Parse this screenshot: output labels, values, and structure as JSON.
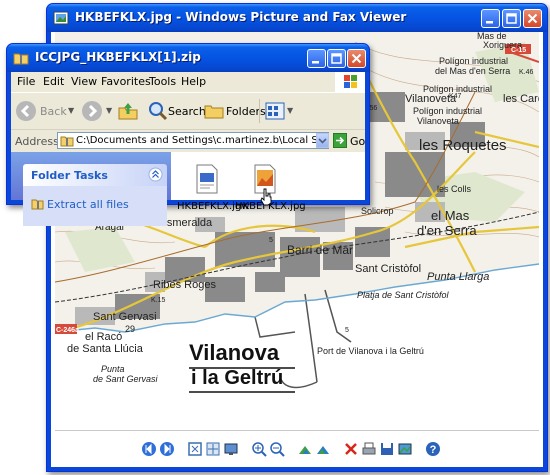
{
  "viewer": {
    "title": "HKBEFKLX.jpg - Windows Picture and Fax Viewer",
    "map_labels": {
      "mas_de_sitja": "Mas de",
      "xoriguera": "Xoriguera",
      "poligon1": "Polígon industrial",
      "mas_serra1": "del Mas d'en Serra",
      "poligon2": "Polígon industrial",
      "vilanoveta": "Vilanoveta",
      "los_cards": "les Cards",
      "poligon3": "Polígon industrial",
      "vilanoveta2": "Vilanoveta",
      "roquetes": "les Roquetes",
      "colls": "les Colls",
      "solicrop": "Solicrop",
      "mas_serra2a": "el Mas",
      "mas_serra2b": "d'en Serra",
      "esmeralda": "l'Esmeralda",
      "aragai": "Aragai",
      "barri_mar": "Barri de Mar",
      "sant_cristofol": "Sant Cristòfol",
      "punta_llarga": "Punta Llarga",
      "ribes_roges": "Ribes Roges",
      "platja_cristofol": "Platja de Sant Cristòfol",
      "sant_gervasi": "Sant Gervasi",
      "raco1": "el Racó",
      "raco2": "de Santa Llúcia",
      "punta": "Punta",
      "punta_gervasi": "de Sant Gervasi",
      "vilanova": "Vilanova",
      "geltru": "i la Geltrú",
      "port": "Port de Vilanova i la Geltrú",
      "road_c246": "C-246a",
      "road_c15": "C-15",
      "road_k47": "K47",
      "road_k15": "K.15",
      "road_k46": "K.46",
      "road_k156": "K.156",
      "km29": "29",
      "num5a": "5",
      "num5b": "5"
    }
  },
  "explorer": {
    "title": "ICCJPG_HKBEFKLX[1].zip",
    "menu": [
      "File",
      "Edit",
      "View",
      "Favorites",
      "Tools",
      "Help"
    ],
    "toolbar": {
      "back": "Back",
      "search": "Search",
      "folders": "Folders"
    },
    "address": {
      "label": "Address",
      "value": "C:\\Documents and Settings\\c.martinez.b\\Local Settings\\Temporar",
      "go": "Go"
    },
    "tasks": {
      "header": "Folder Tasks",
      "extract": "Extract all files"
    },
    "files": [
      {
        "name": "HKBEFKLX.jgw",
        "icon": "text-file-icon"
      },
      {
        "name": "HKBEFKLX.jpg",
        "icon": "image-file-icon"
      }
    ]
  }
}
